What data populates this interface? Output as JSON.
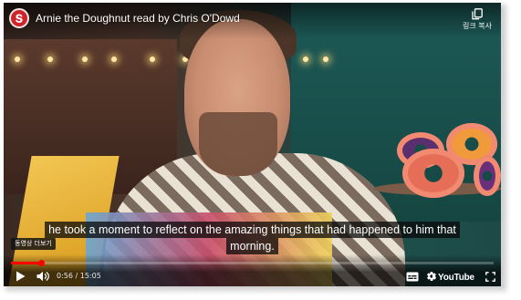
{
  "video": {
    "title": "Arnie the Doughnut read by Chris O'Dowd",
    "caption_lines": [
      "he took a moment to reflect on the amazing things that had happened to him that",
      "morning."
    ]
  },
  "top_actions": {
    "copy_link_label": "링크 복사"
  },
  "overlay": {
    "more_videos_label": "동영상 더보기"
  },
  "controls": {
    "current_time": "0:56",
    "duration": "15:05",
    "time_display": "0:56 / 15:05",
    "progress_fraction": 0.062,
    "youtube_label": "YouTube"
  },
  "icons": {
    "channel_logo": "channel-logo-icon",
    "copy": "copy-icon",
    "play": "play-icon",
    "volume": "volume-icon",
    "captions": "subtitles-icon",
    "settings": "gear-icon",
    "youtube": "youtube-logo-icon",
    "fullscreen": "fullscreen-icon"
  },
  "colors": {
    "progress": "#ff0000",
    "channel_logo_bg": "#d0242b"
  }
}
